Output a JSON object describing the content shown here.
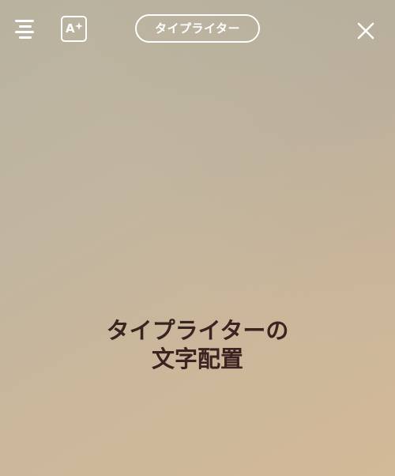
{
  "toolbar": {
    "menu_icon": "hamburger-align-icon",
    "text_style_icon": "text-style-sparkle-icon",
    "text_style_glyph": "A",
    "font_name": "タイプライター",
    "close_icon": "close-icon"
  },
  "canvas": {
    "text": "タイプライターの\n文字配置",
    "text_color": "#3a2320"
  },
  "colors": {
    "icon": "#ffffff",
    "background_top": "#b8b29f",
    "background_bottom": "#d2b998"
  }
}
